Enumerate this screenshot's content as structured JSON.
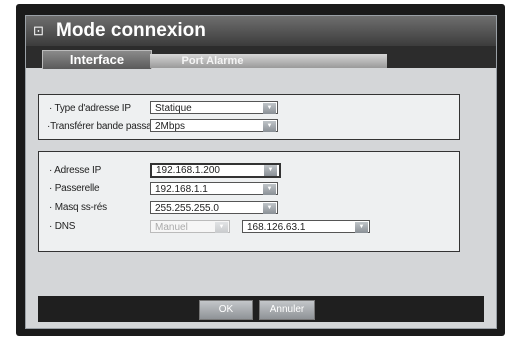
{
  "window": {
    "title": "Mode connexion"
  },
  "tabs": [
    {
      "label": "Interface"
    },
    {
      "label": "Port Alarme"
    },
    {
      "label": ""
    }
  ],
  "section1": {
    "ip_type": {
      "label": "· Type d'adresse IP",
      "value": "Statique"
    },
    "bandwidth": {
      "label": "·Transférer bande passante",
      "value": "2Mbps"
    }
  },
  "section2": {
    "ip_address": {
      "label": "· Adresse IP",
      "value": "192.168.1.200"
    },
    "gateway": {
      "label": "· Passerelle",
      "value": "192.168.1.1"
    },
    "subnet": {
      "label": "· Masq ss-rés",
      "value": "255.255.255.0"
    },
    "dns": {
      "label": "· DNS",
      "mode": "Manuel",
      "value": "168.126.63.1"
    }
  },
  "footer": {
    "ok": "OK",
    "cancel": "Annuler"
  }
}
